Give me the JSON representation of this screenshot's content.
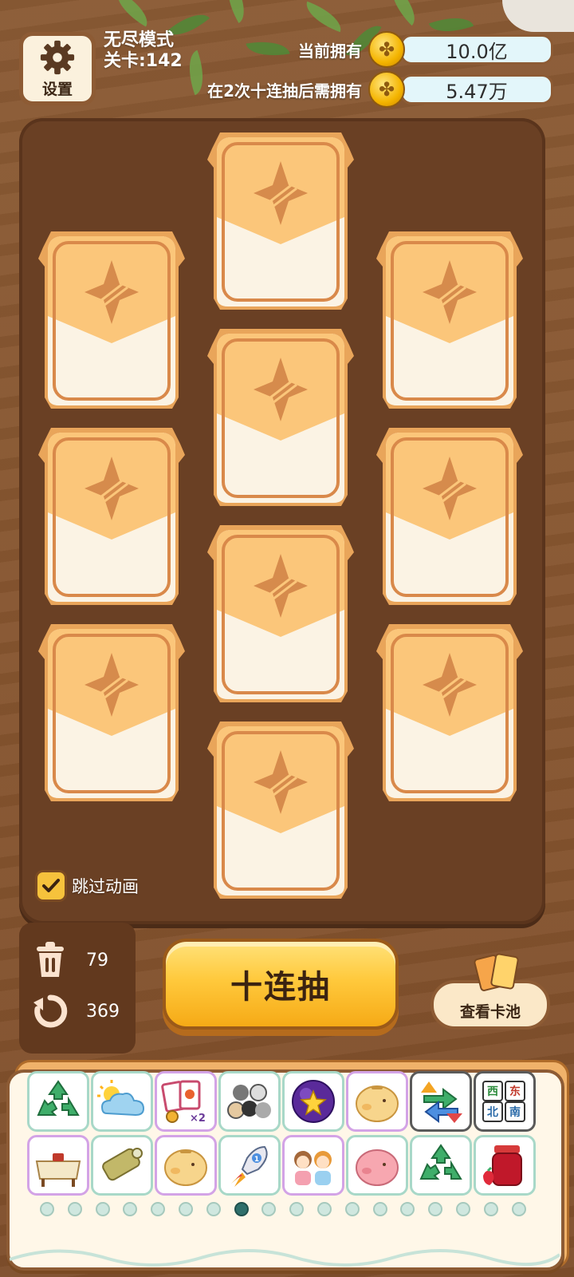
{
  "settings": {
    "label": "设置",
    "icon": "gear-icon"
  },
  "mode": {
    "name": "无尽模式",
    "level": "关卡:142"
  },
  "resources": [
    {
      "label": "当前拥有",
      "value": "10.0亿",
      "icon": "coin-icon"
    },
    {
      "label": "在2次十连抽后需拥有",
      "value": "5.47万",
      "icon": "coin-icon"
    }
  ],
  "cards": {
    "count": 10,
    "state": "face-down",
    "icon": "four-point-star-icon"
  },
  "skip_animation": {
    "label": "跳过动画",
    "checked": true
  },
  "counters": {
    "discard": "79",
    "refresh": "369"
  },
  "draw_button": {
    "label": "十连抽"
  },
  "pool_button": {
    "label": "查看卡池"
  },
  "inventory": {
    "row1": [
      "recycle-icon",
      "cloud-icon",
      "card-x2-icon",
      "cats-icon",
      "star-ball-icon",
      "piggy-bank-icon",
      "swap-arrows-icon",
      "mahjong-tiles-icon"
    ],
    "row2": [
      "table-icon",
      "scroll-icon",
      "piggy-bank-icon",
      "rocket-icon",
      "friends-icon",
      "pink-piggy-icon",
      "recycle-icon",
      "jam-jar-icon"
    ],
    "mahjong_text": [
      "西",
      "东",
      "北",
      "南"
    ],
    "card_x2_text": "×2",
    "rocket_text": "1"
  },
  "pager": {
    "pages": 18,
    "active_index": 7
  },
  "colors": {
    "coin": "#f4b400",
    "button": "#ffc93c",
    "board": "#6a4024",
    "card": "#fbc67a"
  }
}
